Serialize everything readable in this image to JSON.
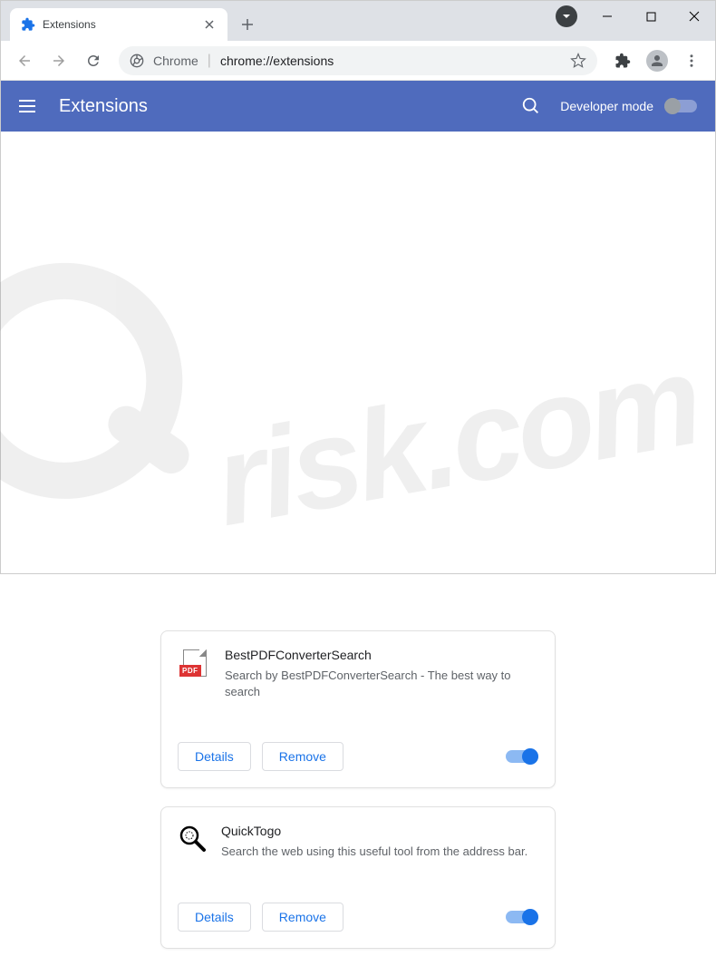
{
  "tab": {
    "title": "Extensions"
  },
  "omnibox": {
    "label": "Chrome",
    "url": "chrome://extensions"
  },
  "header": {
    "title": "Extensions",
    "devmode": "Developer mode"
  },
  "buttons": {
    "details": "Details",
    "remove": "Remove"
  },
  "extensions": [
    {
      "name": "BestPDFConverterSearch",
      "desc": "Search by BestPDFConverterSearch - The best way to search"
    },
    {
      "name": "QuickTogo",
      "desc": "Search the web using this useful tool from the address bar."
    }
  ]
}
